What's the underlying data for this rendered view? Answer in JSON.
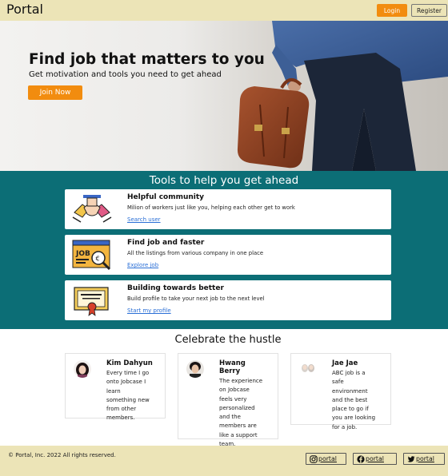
{
  "navbar": {
    "brand": "Portal",
    "login_label": "Login",
    "register_label": "Register"
  },
  "hero": {
    "title": "Find job that matters to you",
    "subtitle": "Get motivation and tools you need to get ahead",
    "cta_label": "Join Now"
  },
  "tools": {
    "heading": "Tools to help you get ahead",
    "cards": [
      {
        "icon": "handshake-icon",
        "title": "Helpful community",
        "description": "Milion of workers just like you, helping each other get to work",
        "link": "Search user"
      },
      {
        "icon": "job-magnifier-icon",
        "title": "Find job and faster",
        "description": "All the listings from various company in one place",
        "link": "Explore job"
      },
      {
        "icon": "certificate-icon",
        "title": "Building towards better",
        "description": "Build profile to take your next job to the next level",
        "link": "Start my profile"
      }
    ]
  },
  "hustle": {
    "heading": "Celebrate the hustle",
    "testimonials": [
      {
        "name": "Kim Dahyun",
        "quote": [
          "Every time I go",
          "onto Jobcase I",
          "learn",
          "something new",
          "from other",
          "members."
        ]
      },
      {
        "name": [
          "Hwang",
          "Berry"
        ],
        "quote": [
          "The experience",
          "on Jobcase",
          "feels very",
          "personalized",
          "and the",
          "members are",
          "like a support",
          "team."
        ]
      },
      {
        "name": "Jae Jae",
        "quote": [
          "ABC job is a",
          "safe",
          "environment",
          "and the best",
          "place to go if",
          "you are looking",
          "for a job."
        ]
      }
    ]
  },
  "footer": {
    "copyright": "© Portal, Inc. 2022 All rights reserved.",
    "social": [
      {
        "icon": "instagram-icon",
        "label": "portal"
      },
      {
        "icon": "facebook-icon",
        "label": "portal"
      },
      {
        "icon": "twitter-icon",
        "label": "portal"
      }
    ]
  },
  "colors": {
    "navbar_bg": "#ece4b7",
    "accent_orange": "#f28c0f",
    "tools_bg": "#0c6e76",
    "link_blue": "#2a6fd6"
  }
}
